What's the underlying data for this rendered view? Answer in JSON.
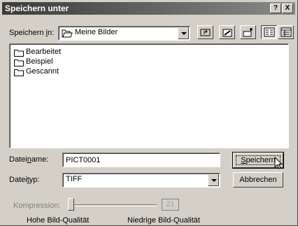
{
  "title_bar": {
    "title": "Speichern unter",
    "help_label": "?",
    "close_label": "X"
  },
  "look_in": {
    "label_pre": "Speichern ",
    "label_accel": "i",
    "label_post": "n:",
    "value": "Meine Bilder"
  },
  "toolbar": {
    "icons": [
      "up-one-level-icon",
      "desktop-icon",
      "new-folder-icon",
      "list-view-icon",
      "details-view-icon"
    ]
  },
  "files": [
    {
      "name": "Bearbeitet",
      "icon": "folder-icon"
    },
    {
      "name": "Beispiel",
      "icon": "folder-icon"
    },
    {
      "name": "Gescannt",
      "icon": "folder-icon"
    }
  ],
  "filename": {
    "label_pre": "Datei",
    "label_accel": "n",
    "label_post": "ame:",
    "value": "PICT0001"
  },
  "filetype": {
    "label_pre": "Datei",
    "label_accel": "t",
    "label_post": "yp:",
    "value": "TIFF"
  },
  "buttons": {
    "save_accel": "S",
    "save_rest": "peichern",
    "cancel": "Abbrechen"
  },
  "compression": {
    "label": "Kompression:",
    "value": "21",
    "high_label": "Hohe Bild-Qualität",
    "low_label": "Niedrige Bild-Qualität"
  },
  "colors": {
    "face": "#d4d0c8",
    "title_start": "#3b3b3b",
    "title_end": "#8a8a8a",
    "disabled_text": "#808080"
  }
}
